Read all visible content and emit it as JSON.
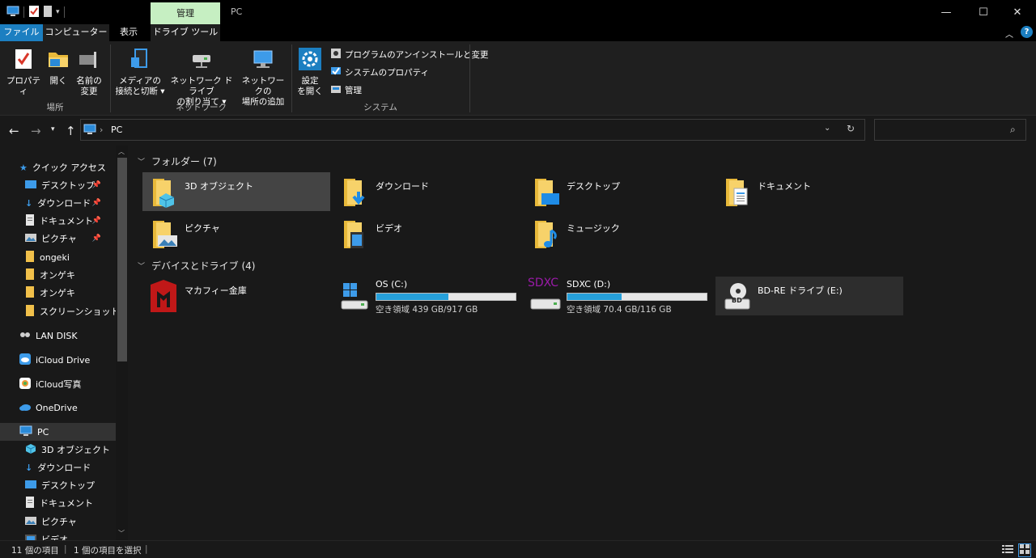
{
  "titlebar": {
    "context_tab": "管理",
    "title": "PC",
    "minimize": "—",
    "maximize": "☐",
    "close": "✕"
  },
  "ribbon_tabs": [
    {
      "label": "ファイル"
    },
    {
      "label": "コンピューター"
    },
    {
      "label": "表示"
    },
    {
      "label": "ドライブ ツール"
    }
  ],
  "ribbon": {
    "location_group": {
      "label": "場所",
      "properties": "プロパティ",
      "open": "開く",
      "rename_1": "名前の",
      "rename_2": "変更"
    },
    "network_group": {
      "label": "ネットワーク",
      "media_1": "メディアの",
      "media_2": "接続と切断 ▾",
      "map_1": "ネットワーク ドライブ",
      "map_2": "の割り当て ▾",
      "add_1": "ネットワークの",
      "add_2": "場所の追加"
    },
    "system_group": {
      "label": "システム",
      "settings_1": "設定",
      "settings_2": "を開く",
      "uninstall": "プログラムのアンインストールと変更",
      "sysprops": "システムのプロパティ",
      "manage": "管理"
    }
  },
  "address": {
    "path_root": "PC",
    "separator": "›"
  },
  "sidebar": {
    "quick_access": "クイック アクセス",
    "qa_items": [
      {
        "label": "デスクトップ"
      },
      {
        "label": "ダウンロード"
      },
      {
        "label": "ドキュメント"
      },
      {
        "label": "ピクチャ"
      },
      {
        "label": "ongeki"
      },
      {
        "label": "オンゲキ"
      },
      {
        "label": "オンゲキ"
      },
      {
        "label": "スクリーンショット"
      }
    ],
    "lan_disk": "LAN DISK",
    "icloud_drive": "iCloud Drive",
    "icloud_photos": "iCloud写真",
    "onedrive": "OneDrive",
    "pc": "PC",
    "pc_items": [
      {
        "label": "3D オブジェクト"
      },
      {
        "label": "ダウンロード"
      },
      {
        "label": "デスクトップ"
      },
      {
        "label": "ドキュメント"
      },
      {
        "label": "ピクチャ"
      },
      {
        "label": "ビデオ"
      }
    ]
  },
  "content": {
    "folders_header": "フォルダー (7)",
    "folders": [
      {
        "name": "3D オブジェクト"
      },
      {
        "name": "ダウンロード"
      },
      {
        "name": "デスクトップ"
      },
      {
        "name": "ドキュメント"
      },
      {
        "name": "ピクチャ"
      },
      {
        "name": "ビデオ"
      },
      {
        "name": "ミュージック"
      }
    ],
    "drives_header": "デバイスとドライブ (4)",
    "drives": [
      {
        "name": "マカフィー金庫"
      },
      {
        "name": "OS (C:)",
        "free": "空き領域 439 GB/917 GB",
        "used_fraction": 0.52
      },
      {
        "name": "SDXC (D:)",
        "free": "空き領域 70.4 GB/116 GB",
        "used_fraction": 0.39,
        "badge": "SDXC"
      },
      {
        "name": "BD-RE ドライブ (E:)",
        "badge": "BD"
      }
    ]
  },
  "statusbar": {
    "count": "11 個の項目",
    "selected": "1 個の項目を選択"
  },
  "colors": {
    "accent": "#1c7fc1",
    "context_tab": "#c6efc2",
    "drive_fill": "#26a0da",
    "selection": "#444444"
  }
}
